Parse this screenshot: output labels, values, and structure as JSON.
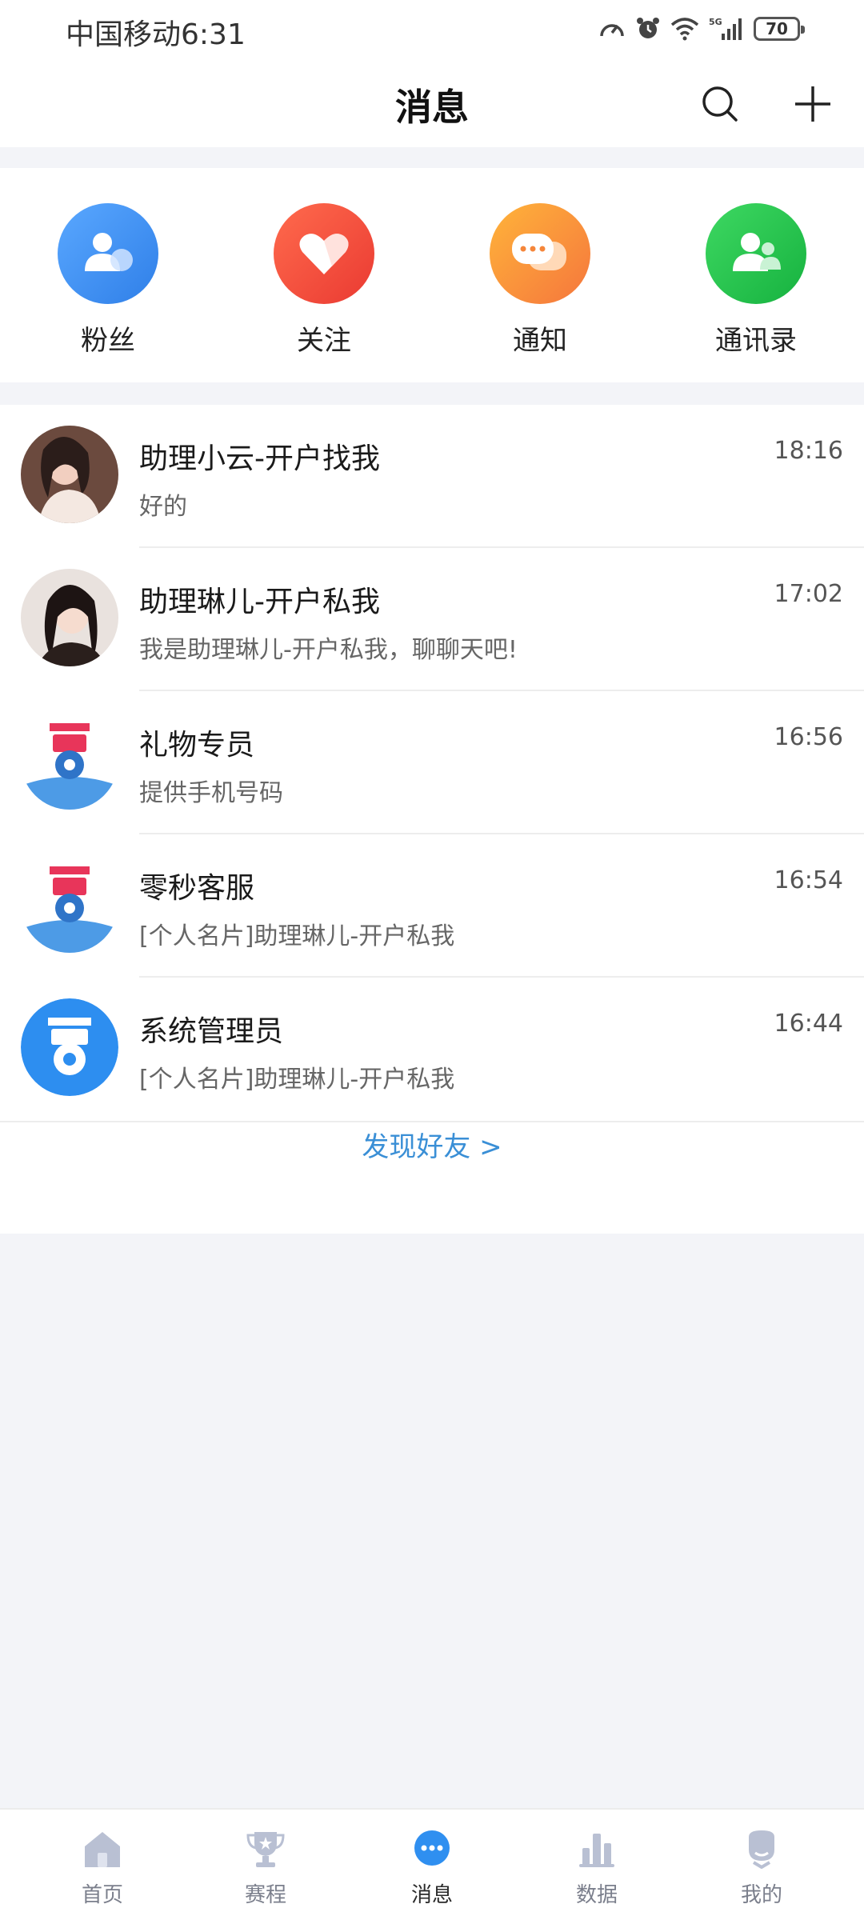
{
  "status_bar": {
    "carrier_time": "中国移动6:31",
    "battery": "70",
    "icons": [
      "speed-icon",
      "alarm-icon",
      "wifi-icon",
      "5g-signal-icon",
      "battery-icon"
    ]
  },
  "header": {
    "title": "消息",
    "search_icon": "search-icon",
    "add_icon": "plus-icon"
  },
  "quick_actions": [
    {
      "label": "粉丝",
      "icon": "fans-icon",
      "color": "#3d8ef2"
    },
    {
      "label": "关注",
      "icon": "heart-icon",
      "color": "#f24a3c"
    },
    {
      "label": "通知",
      "icon": "chat-bubble-icon",
      "color": "#f59a3a"
    },
    {
      "label": "通讯录",
      "icon": "contacts-icon",
      "color": "#21c14a"
    }
  ],
  "conversations": [
    {
      "name": "助理小云-开户找我",
      "time": "18:16",
      "preview": "好的"
    },
    {
      "name": "助理琳儿-开户私我",
      "time": "17:02",
      "preview": "我是助理琳儿-开户私我，聊聊天吧!"
    },
    {
      "name": "礼物专员",
      "time": "16:56",
      "preview": "提供手机号码"
    },
    {
      "name": "零秒客服",
      "time": "16:54",
      "preview": "[个人名片]助理琳儿-开户私我"
    },
    {
      "name": "系统管理员",
      "time": "16:44",
      "preview": "[个人名片]助理琳儿-开户私我"
    }
  ],
  "find_friends": "发现好友 >",
  "bottom_nav": [
    {
      "label": "首页",
      "icon": "home-icon"
    },
    {
      "label": "赛程",
      "icon": "trophy-icon"
    },
    {
      "label": "消息",
      "icon": "message-icon",
      "active": true
    },
    {
      "label": "数据",
      "icon": "stats-icon"
    },
    {
      "label": "我的",
      "icon": "profile-icon"
    }
  ],
  "colors": {
    "accent": "#3a8fd6",
    "nav_inactive": "#b9c0d3",
    "nav_active": "#2f8ff0"
  }
}
